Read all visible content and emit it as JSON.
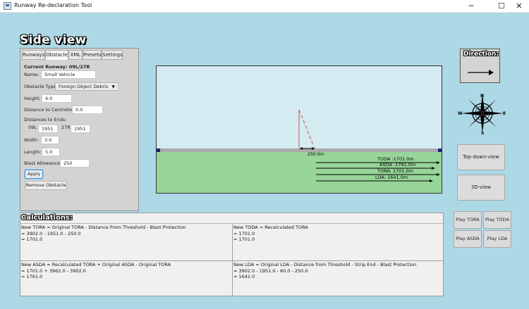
{
  "window": {
    "title": "Runway Re-declaration Tool",
    "minimize_glyph": "─",
    "maximize_glyph": "☐",
    "close_glyph": "✕"
  },
  "view_title": "Side view",
  "tabs": [
    {
      "label": "Runways"
    },
    {
      "label": "Obstacle"
    },
    {
      "label": "XML"
    },
    {
      "label": "Presets"
    },
    {
      "label": "Settings"
    }
  ],
  "obstacle_form": {
    "current_runway": "Current Runway: 09L/27R",
    "name_label": "Name:",
    "name_value": "Small Vehicle",
    "type_label": "Obstacle Type:",
    "type_value": "Foreign Object Debris",
    "height_label": "Height:",
    "height_value": "4.0",
    "centreline_label": "Distance to Centreline:",
    "centreline_value": "0.0",
    "distances_label": "Distances to Ends:",
    "end1_label": "09L",
    "end1_value": "1951",
    "end2_label": "27R",
    "end2_value": "1951",
    "width_label": "Width:",
    "width_value": "3.0",
    "length_label": "Length:",
    "length_value": "5.0",
    "blast_label": "Blast Allowance:",
    "blast_value": "250",
    "apply_label": "Apply",
    "remove_label": "Remove Obstacle"
  },
  "scene": {
    "blast_label": "250.0m",
    "distances": [
      {
        "label": "TODA :1701.0m"
      },
      {
        "label": "ASDA :1761.0m"
      },
      {
        "label": "TORA: 1701.0m"
      },
      {
        "label": "LDA: 1641.0m"
      }
    ],
    "colors": {
      "sky": "#d3ebf1",
      "grass": "#98d598",
      "runway": "#a9a9a9",
      "obstacle": "#d9534f"
    }
  },
  "direction": {
    "label": "Direction:",
    "icon": "arrow-right-icon"
  },
  "compass": {
    "north": "N",
    "south": "S",
    "east": "E",
    "west": "W"
  },
  "view_buttons": {
    "top_down": "Top-down-view",
    "three_d": "3D-view"
  },
  "play_buttons": {
    "tora": "Play TORA",
    "toda": "Play TODA",
    "asda": "Play ASDA",
    "lda": "Play LDA"
  },
  "calculations": {
    "title": "Calculations:",
    "tora": [
      "New TORA = Original TORA  - Distance From Threshold  - Blast Protection",
      "= 3902.0  - 1951.0  - 250.0",
      "= 1701.0"
    ],
    "toda": [
      "New TODA = Recalculated TORA",
      "= 1701.0",
      "= 1701.0"
    ],
    "asda": [
      "New ASDA = Recalculated TORA  + Original ASDA  - Original TORA",
      "= 1701.0  + 3962.0  - 3902.0",
      "= 1761.0"
    ],
    "lda": [
      "New LDA = Original LDA  - Distance from Threshold  - Strip End  - Blast Protection",
      "= 3902.0  - 1951.0  - 60.0  - 250.0",
      "= 1641.0"
    ]
  },
  "colors": {
    "background": "#add8e6",
    "panel": "#d3d3d3",
    "accent_focus": "#3a8fd8"
  }
}
